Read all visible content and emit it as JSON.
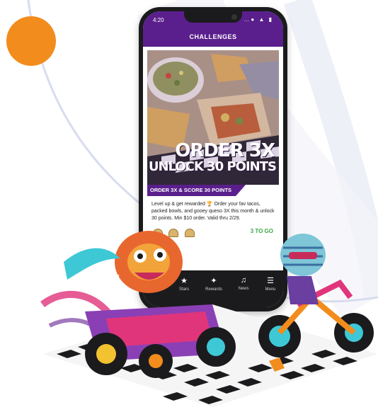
{
  "status_bar": {
    "time": "4:20",
    "icons": "…● ▲ ▮"
  },
  "nav": {
    "title": "CHALLENGES"
  },
  "promo": {
    "headline_line1": "ORDER 3X",
    "headline_line2": "UNLOCK 30 POINTS",
    "banner": "ORDER 3X & SCORE 30 POINTS",
    "body": "Level up & get rewarded 🏆 Order your fav tacos, packed bowls, and gooey queso 3X this month & unlock 30 points. Min $10 order. Valid thru 2/29.",
    "progress_label": "3 TO GO",
    "progress_count": 3
  },
  "tabs": [
    {
      "label": "Stars",
      "icon": "star-icon"
    },
    {
      "label": "Rewards",
      "icon": "rewards-icon"
    },
    {
      "label": "News",
      "icon": "news-icon"
    },
    {
      "label": "Menu",
      "icon": "menu-icon"
    }
  ],
  "colors": {
    "brand_purple": "#5a1f8c",
    "accent_orange": "#f28c1c",
    "progress_green": "#3aa844"
  }
}
